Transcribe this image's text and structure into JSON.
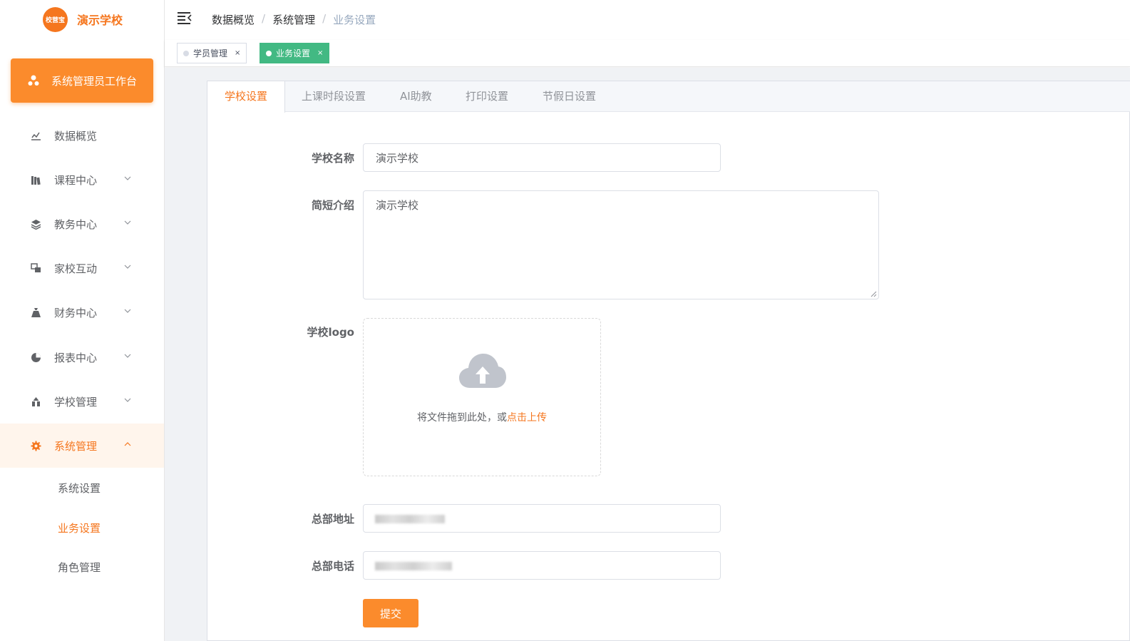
{
  "app": {
    "logo_text": "校营宝",
    "school_name": "演示学校"
  },
  "workbench": {
    "label": "系统管理员工作台"
  },
  "sidebar": {
    "items": [
      {
        "label": "数据概览"
      },
      {
        "label": "课程中心"
      },
      {
        "label": "教务中心"
      },
      {
        "label": "家校互动"
      },
      {
        "label": "财务中心"
      },
      {
        "label": "报表中心"
      },
      {
        "label": "学校管理"
      },
      {
        "label": "系统管理"
      }
    ],
    "sub_items": [
      {
        "label": "系统设置"
      },
      {
        "label": "业务设置"
      },
      {
        "label": "角色管理"
      }
    ]
  },
  "breadcrumb": {
    "items": [
      "数据概览",
      "系统管理",
      "业务设置"
    ],
    "separator": "/"
  },
  "tags": [
    {
      "label": "学员管理",
      "close": "×"
    },
    {
      "label": "业务设置",
      "close": "×"
    }
  ],
  "tabs": [
    {
      "label": "学校设置"
    },
    {
      "label": "上课时段设置"
    },
    {
      "label": "AI助教"
    },
    {
      "label": "打印设置"
    },
    {
      "label": "节假日设置"
    }
  ],
  "form": {
    "school_name_label": "学校名称",
    "school_name_value": "演示学校",
    "intro_label": "简短介绍",
    "intro_value": "演示学校",
    "logo_label": "学校logo",
    "upload_text": "将文件拖到此处，或",
    "upload_link": "点击上传",
    "address_label": "总部地址",
    "phone_label": "总部电话",
    "submit_label": "提交"
  },
  "colors": {
    "accent": "#f5761e",
    "button": "#fb8b2c",
    "active_tag": "#42b983"
  }
}
